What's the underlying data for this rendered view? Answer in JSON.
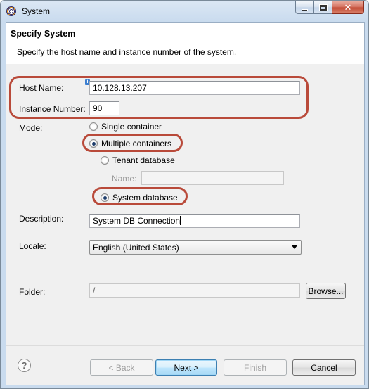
{
  "window": {
    "title": "System",
    "minimize": "–",
    "close": "✕"
  },
  "header": {
    "title": "Specify System",
    "description": "Specify the host name and instance number of the system."
  },
  "form": {
    "host_name": {
      "label": "Host Name:",
      "value": "10.128.13.207",
      "info_icon": "i"
    },
    "instance_number": {
      "label": "Instance Number:",
      "value": "90"
    },
    "mode": {
      "label": "Mode:",
      "options": {
        "single": "Single container",
        "multiple": "Multiple containers",
        "tenant": "Tenant database",
        "system": "System database"
      },
      "selected": "Multiple containers",
      "selected_database": "System database",
      "name_label": "Name:",
      "name_value": ""
    },
    "description": {
      "label": "Description:",
      "value": "System DB Connection"
    },
    "locale": {
      "label": "Locale:",
      "value": "English (United States)"
    },
    "folder": {
      "label": "Folder:",
      "value": "/",
      "browse_label": "Browse..."
    }
  },
  "footer": {
    "help_icon": "?",
    "back_label": "< Back",
    "next_label": "Next >",
    "finish_label": "Finish",
    "cancel_label": "Cancel"
  },
  "colors": {
    "highlight": "#b94a3a",
    "header_bg": "#ffffff",
    "body_bg": "#f0f0f0"
  },
  "icons": {
    "app": "eclipse-icon",
    "help": "help-icon",
    "info": "info-icon"
  }
}
